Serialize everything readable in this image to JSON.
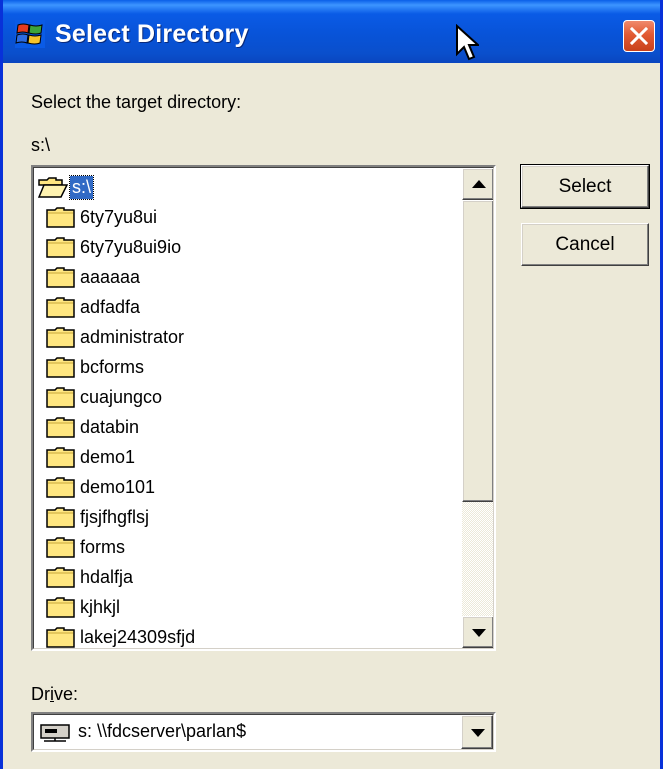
{
  "window": {
    "title": "Select Directory",
    "app_icon": "windows-flag-icon",
    "close_icon": "close-icon"
  },
  "dialog": {
    "prompt_label": "Select the target directory:",
    "current_path": "s:\\",
    "drive_label": "Drive:",
    "drive_value": "s: \\\\fdcserver\\parlan$",
    "drive_icon": "network-drive-icon"
  },
  "directory_list": {
    "root": {
      "label": "s:\\",
      "icon": "open-folder-icon",
      "selected": true
    },
    "items": [
      {
        "label": "6ty7yu8ui",
        "icon": "folder-icon"
      },
      {
        "label": "6ty7yu8ui9io",
        "icon": "folder-icon"
      },
      {
        "label": "aaaaaa",
        "icon": "folder-icon"
      },
      {
        "label": "adfadfa",
        "icon": "folder-icon"
      },
      {
        "label": "administrator",
        "icon": "folder-icon"
      },
      {
        "label": "bcforms",
        "icon": "folder-icon"
      },
      {
        "label": "cuajungco",
        "icon": "folder-icon"
      },
      {
        "label": "databin",
        "icon": "folder-icon"
      },
      {
        "label": "demo1",
        "icon": "folder-icon"
      },
      {
        "label": "demo101",
        "icon": "folder-icon"
      },
      {
        "label": "fjsjfhgflsj",
        "icon": "folder-icon"
      },
      {
        "label": "forms",
        "icon": "folder-icon"
      },
      {
        "label": "hdalfja",
        "icon": "folder-icon"
      },
      {
        "label": "kjhkjl",
        "icon": "folder-icon"
      },
      {
        "label": "lakej24309sfjd",
        "icon": "folder-icon"
      }
    ]
  },
  "buttons": {
    "select_label": "Select",
    "cancel_label": "Cancel"
  },
  "colors": {
    "titlebar": "#0A5BE6",
    "selection": "#316AC5",
    "dialog_face": "#ECE9D8",
    "close_button": "#E25A33",
    "folder": "#FFE680"
  }
}
